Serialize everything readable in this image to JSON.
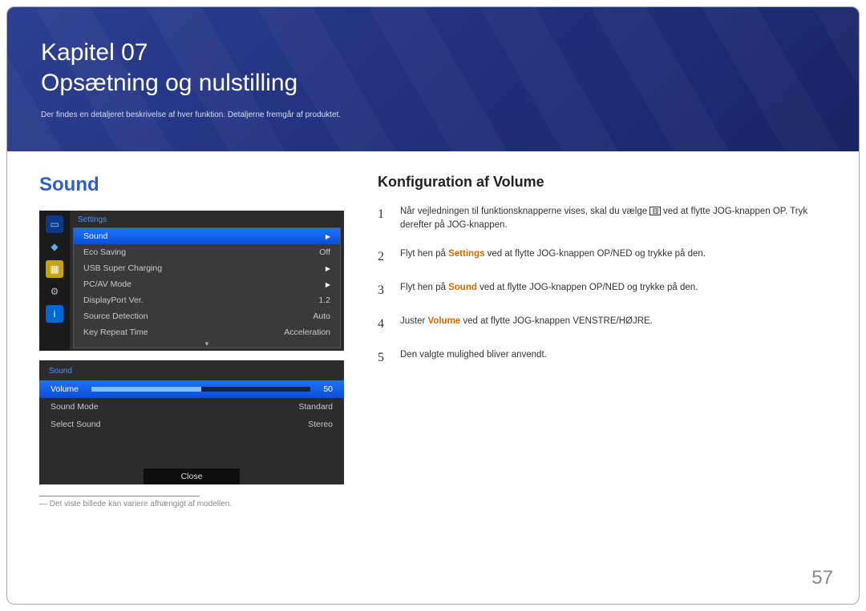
{
  "banner": {
    "chapter_line": "Kapitel 07",
    "title_line": "Opsætning og nulstilling",
    "description": "Der findes en detaljeret beskrivelse af hver funktion. Detaljerne fremgår af produktet."
  },
  "left": {
    "section_title": "Sound",
    "osd_settings": {
      "header": "Settings",
      "rows": [
        {
          "label": "Sound",
          "value": "",
          "selected": true,
          "arrow": true
        },
        {
          "label": "Eco Saving",
          "value": "Off"
        },
        {
          "label": "USB Super Charging",
          "value": "",
          "arrow": true
        },
        {
          "label": "PC/AV Mode",
          "value": "",
          "arrow": true
        },
        {
          "label": "DisplayPort Ver.",
          "value": "1.2"
        },
        {
          "label": "Source Detection",
          "value": "Auto"
        },
        {
          "label": "Key Repeat Time",
          "value": "Acceleration"
        }
      ],
      "scroll_indicator": "▼"
    },
    "osd_sound": {
      "header": "Sound",
      "rows": [
        {
          "label": "Volume",
          "value": "50",
          "selected": true,
          "slider": true
        },
        {
          "label": "Sound Mode",
          "value": "Standard"
        },
        {
          "label": "Select Sound",
          "value": "Stereo"
        }
      ],
      "close": "Close"
    },
    "sidebar_icons": [
      "monitor-icon",
      "rotate-icon",
      "palette-icon",
      "gear-icon",
      "info-icon"
    ],
    "footnote_marker": "―",
    "footnote": "Det viste billede kan variere afhængigt af modellen."
  },
  "right": {
    "subtitle": "Konfiguration af Volume",
    "steps": [
      {
        "n": "1",
        "pre": "Når vejledningen til funktionsknapperne vises, skal du vælge ",
        "glyph": "▥",
        "post": " ved at flytte JOG-knappen OP. Tryk derefter på JOG-knappen."
      },
      {
        "n": "2",
        "pre": "Flyt hen på ",
        "kw": "Settings",
        "kw_class": "kw-settings",
        "post": " ved at flytte JOG-knappen OP/NED og trykke på den."
      },
      {
        "n": "3",
        "pre": "Flyt hen på ",
        "kw": "Sound",
        "kw_class": "kw-sound",
        "post": " ved at flytte JOG-knappen OP/NED og trykke på den."
      },
      {
        "n": "4",
        "pre": "Juster ",
        "kw": "Volume",
        "kw_class": "kw-volume",
        "post": " ved at flytte JOG-knappen VENSTRE/HØJRE."
      },
      {
        "n": "5",
        "pre": "Den valgte mulighed bliver anvendt.",
        "kw": "",
        "post": ""
      }
    ]
  },
  "page_number": "57"
}
